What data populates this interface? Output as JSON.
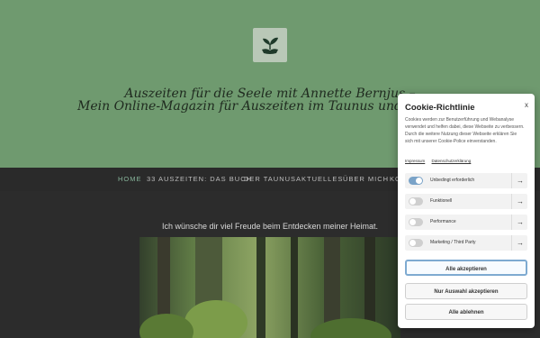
{
  "header": {
    "title_line_1": "Auszeiten für die Seele mit Annette Bernjus –",
    "title_line_2": "Mein Online-Magazin für Auszeiten im Taunus und im Rhein-"
  },
  "nav": {
    "items": [
      {
        "label": "HOME",
        "active": true
      },
      {
        "label": "33 AUSZEITEN: DAS BUCH"
      },
      {
        "label": "DER TAUNUS"
      },
      {
        "label": "AKTUELLES"
      },
      {
        "label": "ÜBER MICH"
      },
      {
        "label": "KO"
      }
    ]
  },
  "content": {
    "welcome": "Ich wünsche dir viel Freude beim Entdecken meiner Heimat."
  },
  "cookie": {
    "title": "Cookie-Richtlinie",
    "close": "x",
    "body": "Cookies werden zur Benutzerführung und Webanalyse verwendet und helfen dabei, diese Webseite zu verbessern. Durch die weitere Nutzung dieser Webseite erklären Sie sich mit unserer Cookie-Police einverstanden.",
    "links": [
      "Impressum",
      "Datenschutzerklärung"
    ],
    "categories": [
      {
        "label": "Unbedingt erforderlich",
        "on": true
      },
      {
        "label": "Funktionell",
        "on": false
      },
      {
        "label": "Performance",
        "on": false
      },
      {
        "label": "Marketing / Third Party",
        "on": false
      }
    ],
    "arrow": "→",
    "buttons": {
      "accept_all": "Alle akzeptieren",
      "accept_selection": "Nur Auswahl akzeptieren",
      "reject_all": "Alle ablehnen"
    },
    "colors": {
      "accent": "#7aa3c8"
    }
  },
  "colors": {
    "header_bg": "#6f9a6f",
    "nav_bg": "#2a2a2a",
    "nav_active": "#87b49a"
  }
}
